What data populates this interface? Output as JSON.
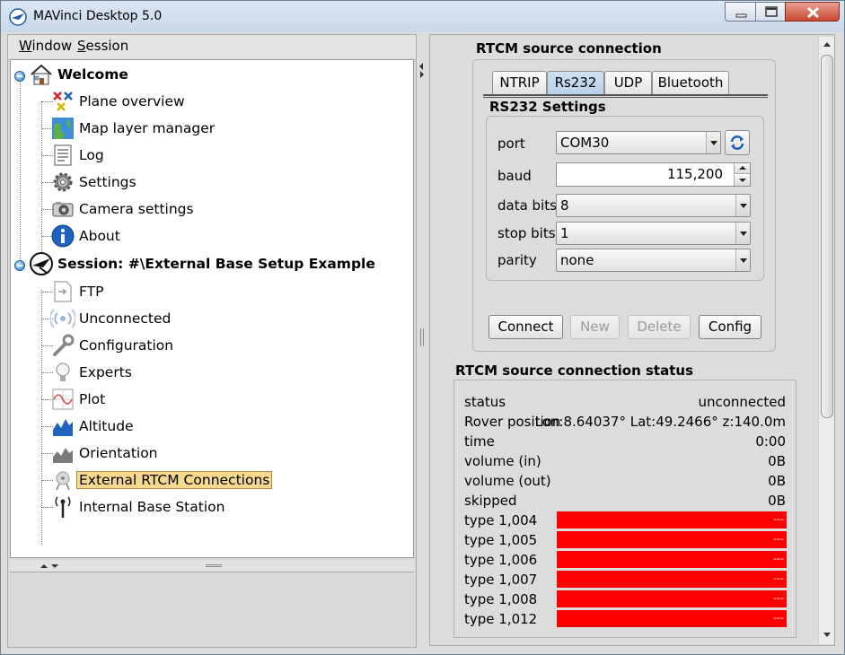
{
  "window": {
    "title": "MAVinci Desktop 5.0",
    "colors": {
      "close_button": "#c6472f",
      "selection": "#f6d88e",
      "status_red": "#ff0000",
      "tab_active": "#b9d0e9"
    }
  },
  "menubar": {
    "items": [
      {
        "label": "Window",
        "accel": "W"
      },
      {
        "label": "Session",
        "accel": "S"
      }
    ]
  },
  "tree": {
    "welcome": {
      "label": "Welcome",
      "icon": "house-icon",
      "children": [
        {
          "label": "Plane overview",
          "icon": "plane-overview-icon"
        },
        {
          "label": "Map layer manager",
          "icon": "globe-icon"
        },
        {
          "label": "Log",
          "icon": "log-document-icon"
        },
        {
          "label": "Settings",
          "icon": "gear-icon"
        },
        {
          "label": "Camera settings",
          "icon": "camera-icon"
        },
        {
          "label": "About",
          "icon": "info-icon"
        }
      ]
    },
    "session": {
      "label": "Session: #\\External Base Setup Example",
      "icon": "session-plane-icon",
      "children": [
        {
          "label": "FTP",
          "icon": "ftp-icon"
        },
        {
          "label": "Unconnected",
          "icon": "wireless-icon"
        },
        {
          "label": "Configuration",
          "icon": "wrench-icon"
        },
        {
          "label": "Experts",
          "icon": "lightbulb-icon"
        },
        {
          "label": "Plot",
          "icon": "plot-icon"
        },
        {
          "label": "Altitude",
          "icon": "altitude-chart-icon"
        },
        {
          "label": "Orientation",
          "icon": "orientation-chart-icon"
        },
        {
          "label": "External RTCM Connections",
          "icon": "satellite-dish-icon",
          "selected": true
        },
        {
          "label": "Internal Base Station",
          "icon": "antenna-icon"
        }
      ]
    }
  },
  "rtcm": {
    "title": "RTCM source connection",
    "tabs": [
      "NTRIP",
      "Rs232",
      "UDP",
      "Bluetooth"
    ],
    "active_tab": "Rs232",
    "settings_title": "RS232 Settings",
    "fields": {
      "port": {
        "label": "port",
        "value": "COM30"
      },
      "baud": {
        "label": "baud",
        "value": "115,200"
      },
      "data_bits": {
        "label": "data bits",
        "value": "8"
      },
      "stop_bits": {
        "label": "stop bits",
        "value": "1"
      },
      "parity": {
        "label": "parity",
        "value": "none"
      }
    },
    "buttons": {
      "connect": "Connect",
      "new": "New",
      "delete": "Delete",
      "config": "Config"
    }
  },
  "status": {
    "title": "RTCM source connection status",
    "rows": [
      {
        "label": "status",
        "value": "unconnected"
      },
      {
        "label": "Rover position",
        "value": "Lon:8.64037° Lat:49.2466° z:140.0m"
      },
      {
        "label": "time",
        "value": "0:00"
      },
      {
        "label": "volume (in)",
        "value": "0B"
      },
      {
        "label": "volume (out)",
        "value": "0B"
      },
      {
        "label": "skipped",
        "value": "0B"
      }
    ],
    "types": [
      {
        "label": "type 1,004",
        "value": "---"
      },
      {
        "label": "type 1,005",
        "value": "---"
      },
      {
        "label": "type 1,006",
        "value": "---"
      },
      {
        "label": "type 1,007",
        "value": "---"
      },
      {
        "label": "type 1,008",
        "value": "---"
      },
      {
        "label": "type 1,012",
        "value": "---"
      }
    ]
  }
}
